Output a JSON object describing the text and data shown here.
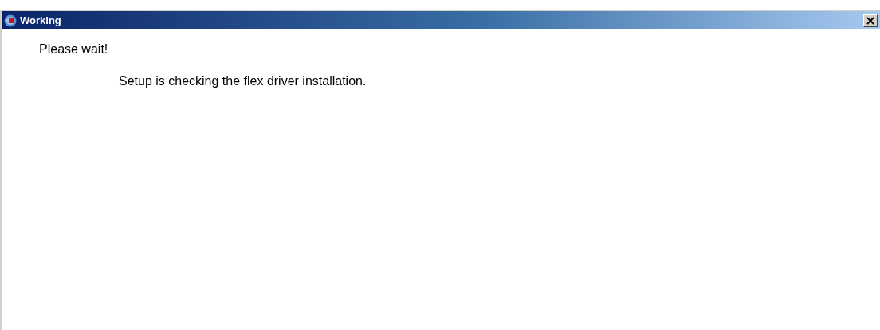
{
  "window": {
    "title": "Working"
  },
  "message": {
    "heading": "Please wait!",
    "detail": "Setup is checking the flex driver installation."
  }
}
